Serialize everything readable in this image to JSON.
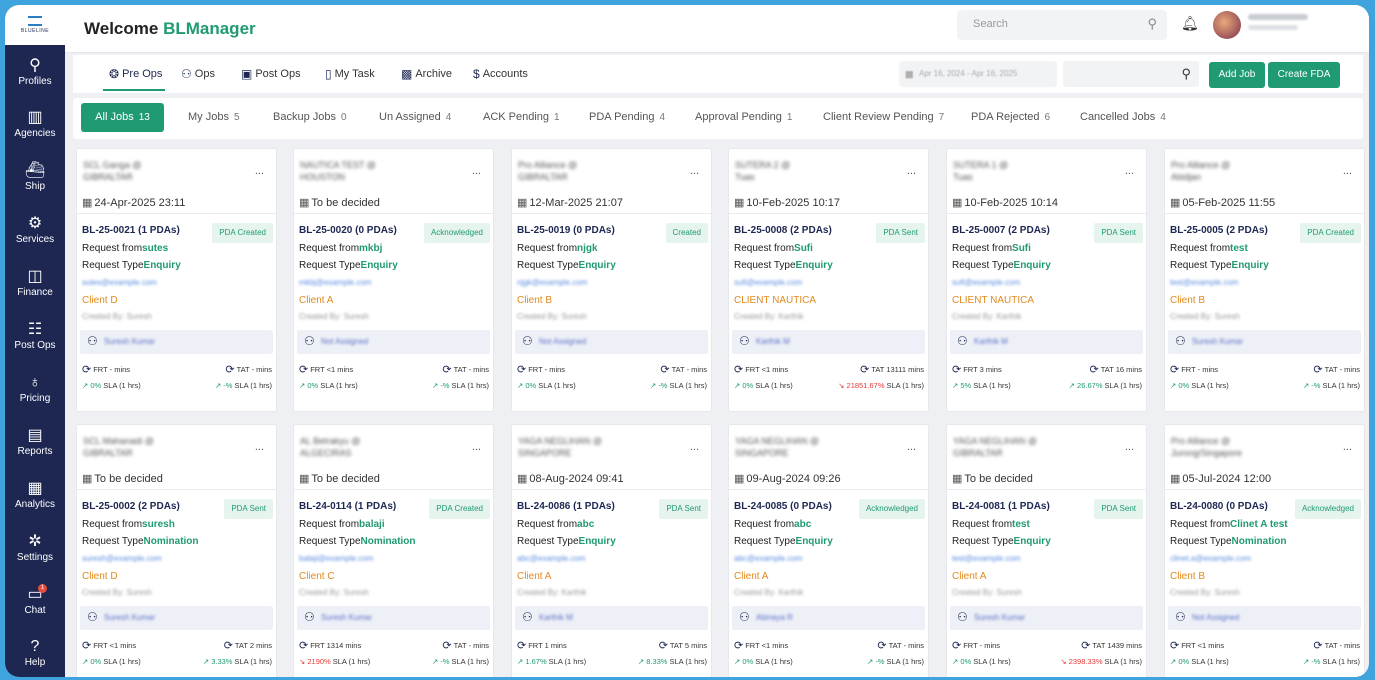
{
  "sidebar": {
    "items": [
      {
        "label": "Profiles",
        "icon": "person-icon",
        "glyph": "⚲"
      },
      {
        "label": "Agencies",
        "icon": "building-icon",
        "glyph": "▥"
      },
      {
        "label": "Ship",
        "icon": "ship-icon",
        "glyph": "⛴"
      },
      {
        "label": "Services",
        "icon": "gear-icon",
        "glyph": "⚙"
      },
      {
        "label": "Finance",
        "icon": "finance-icon",
        "glyph": "◫"
      },
      {
        "label": "Post Ops",
        "icon": "clipboard-icon",
        "glyph": "☷"
      },
      {
        "label": "Pricing",
        "icon": "money-bag-icon",
        "glyph": "♁"
      },
      {
        "label": "Reports",
        "icon": "report-icon",
        "glyph": "▤"
      },
      {
        "label": "Analytics",
        "icon": "chart-icon",
        "glyph": "▦"
      },
      {
        "label": "Settings",
        "icon": "settings-icon",
        "glyph": "✲"
      },
      {
        "label": "Chat",
        "icon": "chat-icon",
        "glyph": "▭",
        "badge": "1"
      },
      {
        "label": "Help",
        "icon": "help-icon",
        "glyph": "?"
      }
    ]
  },
  "header": {
    "welcome": "Welcome ",
    "user": "BLManager",
    "search_placeholder": "Search"
  },
  "toolbar": {
    "items": [
      {
        "label": "Pre Ops",
        "icon": "handshake-icon",
        "glyph": "❂"
      },
      {
        "label": "Ops",
        "icon": "users-icon",
        "glyph": "⚇"
      },
      {
        "label": "Post Ops",
        "icon": "truck-icon",
        "glyph": "▣"
      },
      {
        "label": "My Task",
        "icon": "task-icon",
        "glyph": "▯"
      },
      {
        "label": "Archive",
        "icon": "archive-icon",
        "glyph": "▩"
      },
      {
        "label": "Accounts",
        "icon": "dollar-icon",
        "glyph": "$"
      }
    ],
    "add_job": "Add Job",
    "create_fda": "Create FDA",
    "date_range": "Apr 16, 2024 - Apr 16, 2025"
  },
  "tabs": [
    {
      "label": "All Jobs",
      "count": "13"
    },
    {
      "label": "My Jobs",
      "count": "5"
    },
    {
      "label": "Backup Jobs",
      "count": "0"
    },
    {
      "label": "Un Assigned",
      "count": "4"
    },
    {
      "label": "ACK Pending",
      "count": "1"
    },
    {
      "label": "PDA Pending",
      "count": "4"
    },
    {
      "label": "Approval Pending",
      "count": "1"
    },
    {
      "label": "Client Review Pending",
      "count": "7"
    },
    {
      "label": "PDA Rejected",
      "count": "6"
    },
    {
      "label": "Cancelled Jobs",
      "count": "4"
    }
  ],
  "common": {
    "request_from": "Request from",
    "request_type": "Request Type",
    "dots": "...",
    "sla": "SLA (1 hrs)"
  },
  "cards": [
    {
      "title1": "SCL Ganga @",
      "title2": "GIBRALTAR",
      "date": "24-Apr-2025 23:11",
      "id": "BL-25-0021 (1 PDAs)",
      "status": "PDA Created",
      "from": "sutes",
      "type": "Enquiry",
      "email": "sutes@example.com",
      "client": "Client D",
      "created": "Created By: Suresh",
      "assignee": "Suresh Kumar",
      "frt": "FRT - mins",
      "tat": "TAT - mins",
      "sla_l": "0%",
      "sla_l_dir": "up",
      "sla_r": "-%",
      "sla_r_dir": "up"
    },
    {
      "title1": "NAUTICA TEST @",
      "title2": "HOUSTON",
      "date": "To be decided",
      "id": "BL-25-0020 (0 PDAs)",
      "status": "Acknowledged",
      "from": "mkbj",
      "type": "Enquiry",
      "email": "mkbj@example.com",
      "client": "Client A",
      "created": "Created By: Suresh",
      "assignee": "Not Assigned",
      "frt": "FRT <1 mins",
      "tat": "TAT - mins",
      "sla_l": "0%",
      "sla_l_dir": "up",
      "sla_r": "-%",
      "sla_r_dir": "up"
    },
    {
      "title1": "Pro Alliance @",
      "title2": "GIBRALTAR",
      "date": "12-Mar-2025 21:07",
      "id": "BL-25-0019 (0 PDAs)",
      "status": "Created",
      "from": "njgk",
      "type": "Enquiry",
      "email": "njgk@example.com",
      "client": "Client B",
      "created": "Created By: Suresh",
      "assignee": "Not Assigned",
      "frt": "FRT - mins",
      "tat": "TAT - mins",
      "sla_l": "0%",
      "sla_l_dir": "up",
      "sla_r": "-%",
      "sla_r_dir": "up"
    },
    {
      "title1": "SUTERA 2 @",
      "title2": "Tuas",
      "date": "10-Feb-2025 10:17",
      "id": "BL-25-0008 (2 PDAs)",
      "status": "PDA Sent",
      "from": "Sufi",
      "type": "Enquiry",
      "email": "sufi@example.com",
      "client": "CLIENT NAUTICA",
      "created": "Created By: Karthik",
      "assignee": "Karthik M",
      "frt": "FRT <1 mins",
      "tat": "TAT 13111 mins",
      "sla_l": "0%",
      "sla_l_dir": "up",
      "sla_r": "21851.67%",
      "sla_r_dir": "dn"
    },
    {
      "title1": "SUTERA 1 @",
      "title2": "Tuas",
      "date": "10-Feb-2025 10:14",
      "id": "BL-25-0007 (2 PDAs)",
      "status": "PDA Sent",
      "from": "Sufi",
      "type": "Enquiry",
      "email": "sufi@example.com",
      "client": "CLIENT NAUTICA",
      "created": "Created By: Karthik",
      "assignee": "Karthik M",
      "frt": "FRT 3 mins",
      "tat": "TAT 16 mins",
      "sla_l": "5%",
      "sla_l_dir": "up",
      "sla_r": "26.67%",
      "sla_r_dir": "up"
    },
    {
      "title1": "Pro Alliance @",
      "title2": "Abidjan",
      "date": "05-Feb-2025 11:55",
      "id": "BL-25-0005 (2 PDAs)",
      "status": "PDA Created",
      "from": "test",
      "type": "Enquiry",
      "email": "test@example.com",
      "client": "Client B",
      "created": "Created By: Suresh",
      "assignee": "Suresh Kumar",
      "frt": "FRT - mins",
      "tat": "TAT - mins",
      "sla_l": "0%",
      "sla_l_dir": "up",
      "sla_r": "-%",
      "sla_r_dir": "up"
    },
    {
      "title1": "SCL Mahanadi @",
      "title2": "GIBRALTAR",
      "date": "To be decided",
      "id": "BL-25-0002 (2 PDAs)",
      "status": "PDA Sent",
      "from": "suresh",
      "type": "Nomination",
      "email": "suresh@example.com",
      "client": "Client D",
      "created": "Created By: Suresh",
      "assignee": "Suresh Kumar",
      "frt": "FRT <1 mins",
      "tat": "TAT 2 mins",
      "sla_l": "0%",
      "sla_l_dir": "up",
      "sla_r": "3.33%",
      "sla_r_dir": "up"
    },
    {
      "title1": "AL Betrakyu @",
      "title2": "ALGECIRAS",
      "date": "To be decided",
      "id": "BL-24-0114 (1 PDAs)",
      "status": "PDA Created",
      "from": "balaji",
      "type": "Nomination",
      "email": "balaji@example.com",
      "client": "Client C",
      "created": "Created By: Suresh",
      "assignee": "Suresh Kumar",
      "frt": "FRT 1314 mins",
      "tat": "TAT - mins",
      "sla_l": "2190%",
      "sla_l_dir": "dn",
      "sla_r": "-%",
      "sla_r_dir": "up"
    },
    {
      "title1": "YAGA NEGLIHAN @",
      "title2": "SINGAPORE",
      "date": "08-Aug-2024 09:41",
      "id": "BL-24-0086 (1 PDAs)",
      "status": "PDA Sent",
      "from": "abc",
      "type": "Enquiry",
      "email": "abc@example.com",
      "client": "Client A",
      "created": "Created By: Karthik",
      "assignee": "Karthik M",
      "frt": "FRT 1 mins",
      "tat": "TAT 5 mins",
      "sla_l": "1.67%",
      "sla_l_dir": "up",
      "sla_r": "8.33%",
      "sla_r_dir": "up"
    },
    {
      "title1": "YAGA NEGLIHAN @",
      "title2": "SINGAPORE",
      "date": "09-Aug-2024 09:26",
      "id": "BL-24-0085 (0 PDAs)",
      "status": "Acknowledged",
      "from": "abc",
      "type": "Enquiry",
      "email": "abc@example.com",
      "client": "Client A",
      "created": "Created By: Karthik",
      "assignee": "Abinaya R",
      "frt": "FRT <1 mins",
      "tat": "TAT - mins",
      "sla_l": "0%",
      "sla_l_dir": "up",
      "sla_r": "-%",
      "sla_r_dir": "up"
    },
    {
      "title1": "YAGA NEGLIHAN @",
      "title2": "GIBRALTAR",
      "date": "To be decided",
      "id": "BL-24-0081 (1 PDAs)",
      "status": "PDA Sent",
      "from": "test",
      "type": "Enquiry",
      "email": "test@example.com",
      "client": "Client A",
      "created": "Created By: Suresh",
      "assignee": "Suresh Kumar",
      "frt": "FRT - mins",
      "tat": "TAT 1439 mins",
      "sla_l": "0%",
      "sla_l_dir": "up",
      "sla_r": "2398.33%",
      "sla_r_dir": "dn"
    },
    {
      "title1": "Pro Alliance @",
      "title2": "Jurong/Singapore",
      "date": "05-Jul-2024 12:00",
      "id": "BL-24-0080 (0 PDAs)",
      "status": "Acknowledged",
      "from": "Clinet A test",
      "type": "Nomination",
      "email": "clinet.a@example.com",
      "client": "Client B",
      "created": "Created By: Suresh",
      "assignee": "Not Assigned",
      "frt": "FRT <1 mins",
      "tat": "TAT - mins",
      "sla_l": "0%",
      "sla_l_dir": "up",
      "sla_r": "-%",
      "sla_r_dir": "up"
    }
  ],
  "colors": {
    "sidebar": "#1d2752",
    "accent": "#1f9a73",
    "client": "#e08a1e",
    "down": "#e53935"
  }
}
